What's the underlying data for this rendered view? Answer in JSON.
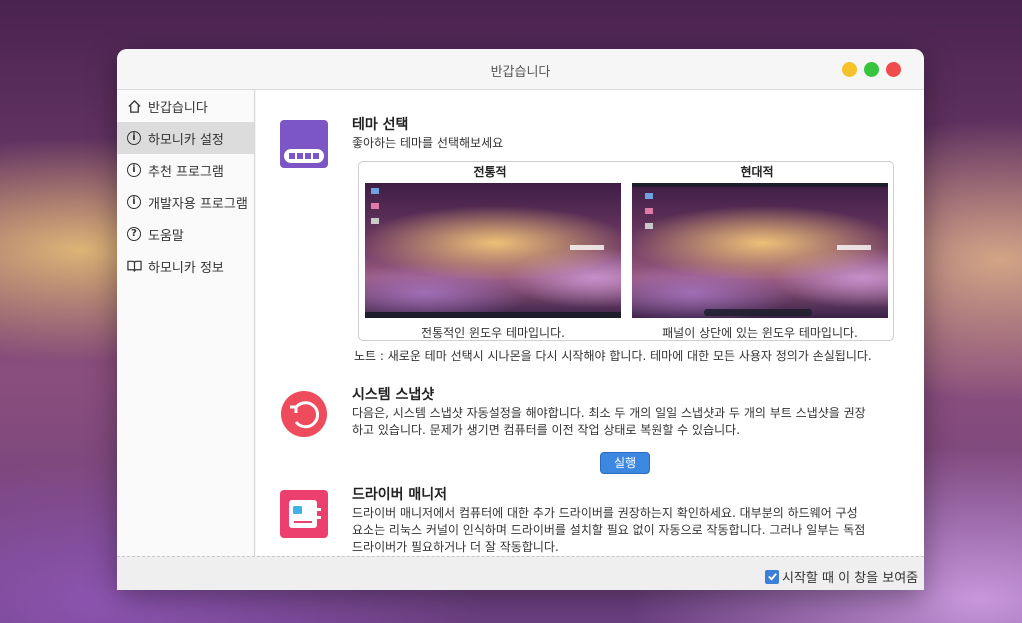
{
  "window": {
    "title": "반갑습니다"
  },
  "sidebar": {
    "items": [
      {
        "label": "반갑습니다",
        "icon": "home-icon"
      },
      {
        "label": "하모니카 설정",
        "icon": "info-icon",
        "active": true
      },
      {
        "label": "추천 프로그램",
        "icon": "info-icon"
      },
      {
        "label": "개발자용 프로그램",
        "icon": "info-icon"
      },
      {
        "label": "도움말",
        "icon": "help-icon"
      },
      {
        "label": "하모니카 정보",
        "icon": "book-icon"
      }
    ]
  },
  "theme": {
    "title": "테마 선택",
    "subtitle": "좋아하는 테마를 선택해보세요",
    "options": [
      {
        "name": "전통적",
        "caption": "전통적인 윈도우 테마입니다."
      },
      {
        "name": "현대적",
        "caption": "패널이 상단에 있는 윈도우 테마입니다."
      }
    ],
    "note": "노트 : 새로운 테마 선택시 시나몬을 다시 시작해야 합니다. 테마에 대한 모든 사용자 정의가 손실됩니다."
  },
  "snapshot": {
    "title": "시스템 스냅샷",
    "line1": "다음은, 시스템 스냅샷 자동설정을 해야합니다. 최소 두 개의 일일 스냅샷과 두 개의 부트 스냅샷을 권장",
    "line2": "하고 있습니다. 문제가 생기면 컴퓨터를 이전 작업 상태로 복원할 수 있습니다.",
    "button": "실행"
  },
  "driver": {
    "title": "드라이버 매니저",
    "line1": "드라이버 매니저에서 컴퓨터에 대한 추가 드라이버를 권장하는지 확인하세요. 대부분의 하드웨어 구성",
    "line2": "요소는 리눅스 커널이 인식하며 드라이버를 설치할 필요 없이 자동으로 작동합니다. 그러나 일부는 독점",
    "line3": "드라이버가 필요하거나 더 잘 작동합니다."
  },
  "footer": {
    "checkbox_label": "시작할 때 이 창을 보여줌",
    "checked": true
  },
  "colors": {
    "accent": "#3c87e0",
    "theme_icon": "#7c56c4",
    "snapshot_icon": "#ee4b5c",
    "driver_icon": "#ec3f6e"
  }
}
